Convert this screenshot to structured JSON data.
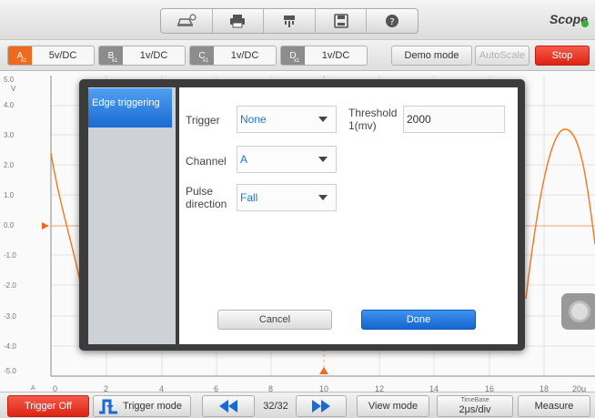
{
  "toolbar": {
    "icons": [
      "car-settings-icon",
      "printer-icon",
      "pin-icon",
      "save-icon",
      "help-icon"
    ],
    "logo": "Scope"
  },
  "channels": [
    {
      "id": "A",
      "sub": "x1",
      "value": "5v/DC",
      "color": "#ee6a1e"
    },
    {
      "id": "B",
      "sub": "x1",
      "value": "1v/DC",
      "color": "#8c8c8c"
    },
    {
      "id": "C",
      "sub": "x1",
      "value": "1v/DC",
      "color": "#8c8c8c"
    },
    {
      "id": "D",
      "sub": "x1",
      "value": "1v/DC",
      "color": "#8c8c8c"
    }
  ],
  "controls": {
    "demo_mode": "Demo mode",
    "autoscale": "AutoScale",
    "stop": "Stop"
  },
  "plot": {
    "y_unit": "V",
    "y_labels": [
      "5.0",
      "4.0",
      "3.0",
      "2.0",
      "1.0",
      "0.0",
      "-1.0",
      "-2.0",
      "-3.0",
      "-4.0",
      "-5.0"
    ],
    "x_labels": [
      "0",
      "2",
      "4",
      "6",
      "8",
      "10",
      "12",
      "14",
      "16",
      "18",
      "20µ"
    ],
    "x_channel": "A",
    "wave_color": "#f0771e"
  },
  "dialog": {
    "tab": "Edge triggering",
    "trigger_label": "Trigger",
    "trigger_value": "None",
    "threshold_label": "Threshold 1(mv)",
    "threshold_value": "2000",
    "channel_label": "Channel",
    "channel_value": "A",
    "pulse_label": "Pulse direction",
    "pulse_value": "Fall",
    "cancel": "Cancel",
    "done": "Done"
  },
  "bottom": {
    "trigger_off": "Trigger Off",
    "trigger_mode": "Trigger mode",
    "page": "32/32",
    "view_mode": "View mode",
    "timebase_label": "TimeBase",
    "timebase_value": "2μs/div",
    "measure": "Measure"
  }
}
